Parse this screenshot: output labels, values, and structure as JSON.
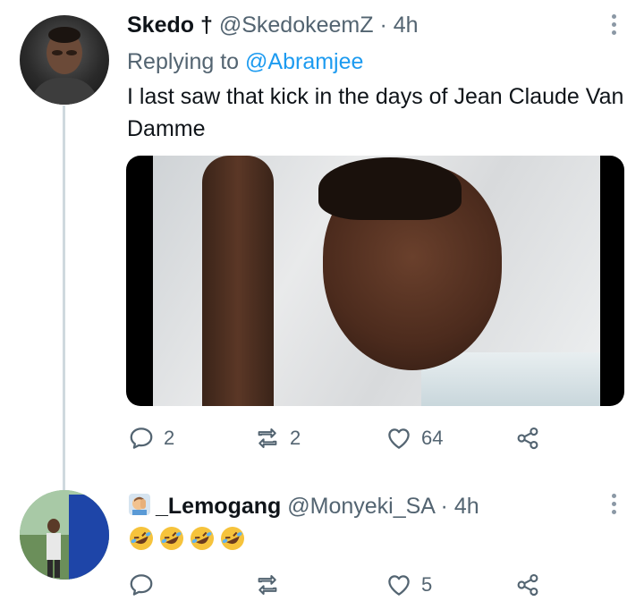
{
  "tweet1": {
    "display_name": "Skedo †",
    "handle": "@SkedokeemZ",
    "separator": "·",
    "time": "4h",
    "replying_prefix": "Replying to ",
    "replying_to": "@Abramjee",
    "text": "I last saw that kick in the days of Jean Claude Van Damme",
    "replies": "2",
    "retweets": "2",
    "likes": "64"
  },
  "tweet2": {
    "display_name": "_Lemogang",
    "handle": "@Monyeki_SA",
    "separator": "·",
    "time": "4h",
    "replies": "",
    "retweets": "",
    "likes": "5"
  },
  "icons": {
    "reply": "reply-icon",
    "retweet": "retweet-icon",
    "like": "heart-icon",
    "share": "share-icon",
    "more": "more-icon"
  },
  "colors": {
    "text_primary": "#0f1419",
    "text_secondary": "#536471",
    "link": "#1d9bf0",
    "thread_line": "#cfd9de"
  }
}
